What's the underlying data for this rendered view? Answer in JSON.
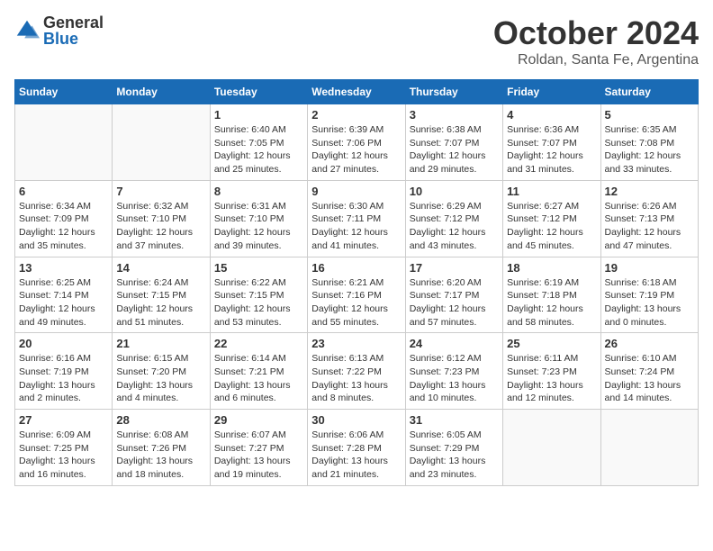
{
  "header": {
    "logo_general": "General",
    "logo_blue": "Blue",
    "month_title": "October 2024",
    "location": "Roldan, Santa Fe, Argentina"
  },
  "columns": [
    "Sunday",
    "Monday",
    "Tuesday",
    "Wednesday",
    "Thursday",
    "Friday",
    "Saturday"
  ],
  "weeks": [
    [
      {
        "day": "",
        "info": ""
      },
      {
        "day": "",
        "info": ""
      },
      {
        "day": "1",
        "info": "Sunrise: 6:40 AM\nSunset: 7:05 PM\nDaylight: 12 hours\nand 25 minutes."
      },
      {
        "day": "2",
        "info": "Sunrise: 6:39 AM\nSunset: 7:06 PM\nDaylight: 12 hours\nand 27 minutes."
      },
      {
        "day": "3",
        "info": "Sunrise: 6:38 AM\nSunset: 7:07 PM\nDaylight: 12 hours\nand 29 minutes."
      },
      {
        "day": "4",
        "info": "Sunrise: 6:36 AM\nSunset: 7:07 PM\nDaylight: 12 hours\nand 31 minutes."
      },
      {
        "day": "5",
        "info": "Sunrise: 6:35 AM\nSunset: 7:08 PM\nDaylight: 12 hours\nand 33 minutes."
      }
    ],
    [
      {
        "day": "6",
        "info": "Sunrise: 6:34 AM\nSunset: 7:09 PM\nDaylight: 12 hours\nand 35 minutes."
      },
      {
        "day": "7",
        "info": "Sunrise: 6:32 AM\nSunset: 7:10 PM\nDaylight: 12 hours\nand 37 minutes."
      },
      {
        "day": "8",
        "info": "Sunrise: 6:31 AM\nSunset: 7:10 PM\nDaylight: 12 hours\nand 39 minutes."
      },
      {
        "day": "9",
        "info": "Sunrise: 6:30 AM\nSunset: 7:11 PM\nDaylight: 12 hours\nand 41 minutes."
      },
      {
        "day": "10",
        "info": "Sunrise: 6:29 AM\nSunset: 7:12 PM\nDaylight: 12 hours\nand 43 minutes."
      },
      {
        "day": "11",
        "info": "Sunrise: 6:27 AM\nSunset: 7:12 PM\nDaylight: 12 hours\nand 45 minutes."
      },
      {
        "day": "12",
        "info": "Sunrise: 6:26 AM\nSunset: 7:13 PM\nDaylight: 12 hours\nand 47 minutes."
      }
    ],
    [
      {
        "day": "13",
        "info": "Sunrise: 6:25 AM\nSunset: 7:14 PM\nDaylight: 12 hours\nand 49 minutes."
      },
      {
        "day": "14",
        "info": "Sunrise: 6:24 AM\nSunset: 7:15 PM\nDaylight: 12 hours\nand 51 minutes."
      },
      {
        "day": "15",
        "info": "Sunrise: 6:22 AM\nSunset: 7:15 PM\nDaylight: 12 hours\nand 53 minutes."
      },
      {
        "day": "16",
        "info": "Sunrise: 6:21 AM\nSunset: 7:16 PM\nDaylight: 12 hours\nand 55 minutes."
      },
      {
        "day": "17",
        "info": "Sunrise: 6:20 AM\nSunset: 7:17 PM\nDaylight: 12 hours\nand 57 minutes."
      },
      {
        "day": "18",
        "info": "Sunrise: 6:19 AM\nSunset: 7:18 PM\nDaylight: 12 hours\nand 58 minutes."
      },
      {
        "day": "19",
        "info": "Sunrise: 6:18 AM\nSunset: 7:19 PM\nDaylight: 13 hours\nand 0 minutes."
      }
    ],
    [
      {
        "day": "20",
        "info": "Sunrise: 6:16 AM\nSunset: 7:19 PM\nDaylight: 13 hours\nand 2 minutes."
      },
      {
        "day": "21",
        "info": "Sunrise: 6:15 AM\nSunset: 7:20 PM\nDaylight: 13 hours\nand 4 minutes."
      },
      {
        "day": "22",
        "info": "Sunrise: 6:14 AM\nSunset: 7:21 PM\nDaylight: 13 hours\nand 6 minutes."
      },
      {
        "day": "23",
        "info": "Sunrise: 6:13 AM\nSunset: 7:22 PM\nDaylight: 13 hours\nand 8 minutes."
      },
      {
        "day": "24",
        "info": "Sunrise: 6:12 AM\nSunset: 7:23 PM\nDaylight: 13 hours\nand 10 minutes."
      },
      {
        "day": "25",
        "info": "Sunrise: 6:11 AM\nSunset: 7:23 PM\nDaylight: 13 hours\nand 12 minutes."
      },
      {
        "day": "26",
        "info": "Sunrise: 6:10 AM\nSunset: 7:24 PM\nDaylight: 13 hours\nand 14 minutes."
      }
    ],
    [
      {
        "day": "27",
        "info": "Sunrise: 6:09 AM\nSunset: 7:25 PM\nDaylight: 13 hours\nand 16 minutes."
      },
      {
        "day": "28",
        "info": "Sunrise: 6:08 AM\nSunset: 7:26 PM\nDaylight: 13 hours\nand 18 minutes."
      },
      {
        "day": "29",
        "info": "Sunrise: 6:07 AM\nSunset: 7:27 PM\nDaylight: 13 hours\nand 19 minutes."
      },
      {
        "day": "30",
        "info": "Sunrise: 6:06 AM\nSunset: 7:28 PM\nDaylight: 13 hours\nand 21 minutes."
      },
      {
        "day": "31",
        "info": "Sunrise: 6:05 AM\nSunset: 7:29 PM\nDaylight: 13 hours\nand 23 minutes."
      },
      {
        "day": "",
        "info": ""
      },
      {
        "day": "",
        "info": ""
      }
    ]
  ]
}
